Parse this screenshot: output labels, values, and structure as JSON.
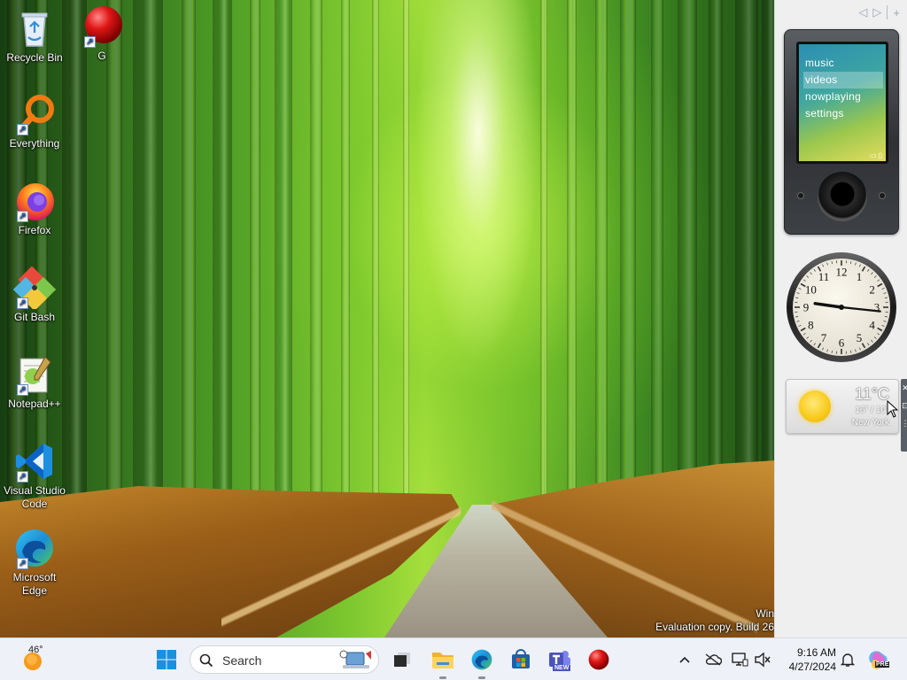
{
  "desktop": {
    "icons": [
      {
        "label": "Recycle Bin",
        "icon": "recycle-bin-icon"
      },
      {
        "label": "G",
        "icon": "red-ball-icon"
      },
      {
        "label": "Everything",
        "icon": "magnifier-icon"
      },
      {
        "label": "Firefox",
        "icon": "firefox-icon"
      },
      {
        "label": "Git Bash",
        "icon": "git-bash-icon"
      },
      {
        "label": "Notepad++",
        "icon": "notepadpp-icon"
      },
      {
        "label": "Visual Studio Code",
        "icon": "vscode-icon"
      },
      {
        "label": "Microsoft Edge",
        "icon": "edge-icon"
      }
    ],
    "watermark": {
      "line1": "Win",
      "line2": "Evaluation copy. Build 26"
    }
  },
  "sidebar": {
    "controls": {
      "prev": "◁",
      "next": "▷",
      "add": "+"
    },
    "media_player": {
      "menu": [
        "music",
        "videos",
        "nowplaying",
        "settings"
      ],
      "selected": "videos"
    },
    "clock": {
      "time": "9:16",
      "numerals": [
        "12",
        "1",
        "2",
        "3",
        "4",
        "5",
        "6",
        "7",
        "8",
        "9",
        "10",
        "11"
      ]
    },
    "weather": {
      "temp": "11°C",
      "range": "16° / 10°",
      "city": "New York",
      "condition_icon": "sun-icon"
    },
    "gadget_toolbar": {
      "close": "✕",
      "options": "⊡",
      "drag": "⋮"
    }
  },
  "taskbar": {
    "weather": {
      "temp": "46°",
      "icon": "sun-weather-icon"
    },
    "search": {
      "placeholder": "Search"
    },
    "apps": [
      {
        "name": "start",
        "icon": "windows-start-icon"
      },
      {
        "name": "task-view",
        "icon": "task-view-icon"
      },
      {
        "name": "file-explorer",
        "icon": "folder-icon"
      },
      {
        "name": "edge",
        "icon": "edge-icon"
      },
      {
        "name": "store",
        "icon": "store-icon"
      },
      {
        "name": "teams",
        "icon": "teams-icon",
        "badge": "NEW"
      },
      {
        "name": "g-app",
        "icon": "red-ball-icon"
      }
    ],
    "tray": {
      "time": "9:16 AM",
      "date": "4/27/2024",
      "copilot_badge": "PRE"
    }
  },
  "colors": {
    "taskbar_bg": "#eef1f7",
    "sidebar_bg": "#efefef",
    "accent": "#0a64c8"
  }
}
